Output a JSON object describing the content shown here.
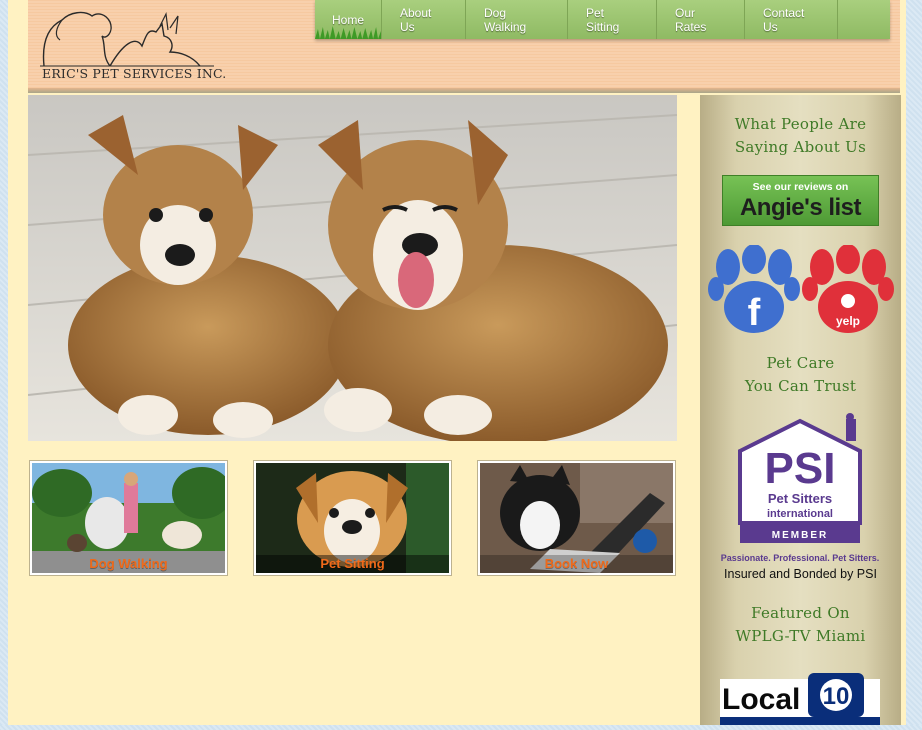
{
  "header": {
    "logo_text": "ERIC'S PET SERVICES INC."
  },
  "nav": {
    "items": [
      {
        "label": "Home"
      },
      {
        "label": "About Us"
      },
      {
        "label": "Dog Walking"
      },
      {
        "label": "Pet Sitting"
      },
      {
        "label": "Our Rates"
      },
      {
        "label": "Contact Us"
      }
    ]
  },
  "thumbnails": [
    {
      "label": "Dog Walking"
    },
    {
      "label": "Pet Sitting"
    },
    {
      "label": "Book Now"
    }
  ],
  "sidebar": {
    "testimonials_line1": "What People Are",
    "testimonials_line2": "Saying About Us",
    "angies_top": "See our reviews on",
    "angies_main": "Angie's list",
    "facebook_label": "f",
    "yelp_label": "yelp",
    "trust_line1": "Pet Care",
    "trust_line2": "You Can Trust",
    "psi_letters": "PSI",
    "psi_name1": "Pet Sitters",
    "psi_name2": "international",
    "psi_member": "MEMBER",
    "psi_tagline": "Passionate. Professional. Pet Sitters.",
    "psi_insured": "Insured and Bonded by PSI",
    "featured_line1": "Featured On",
    "featured_line2": "WPLG-TV Miami",
    "local10_text": "Local",
    "local10_number": "10"
  },
  "colors": {
    "nav_green": "#9cc670",
    "label_orange": "#ef6a1a",
    "sidebar_heading": "#3f7a27",
    "psi_purple": "#5a3a8f"
  }
}
